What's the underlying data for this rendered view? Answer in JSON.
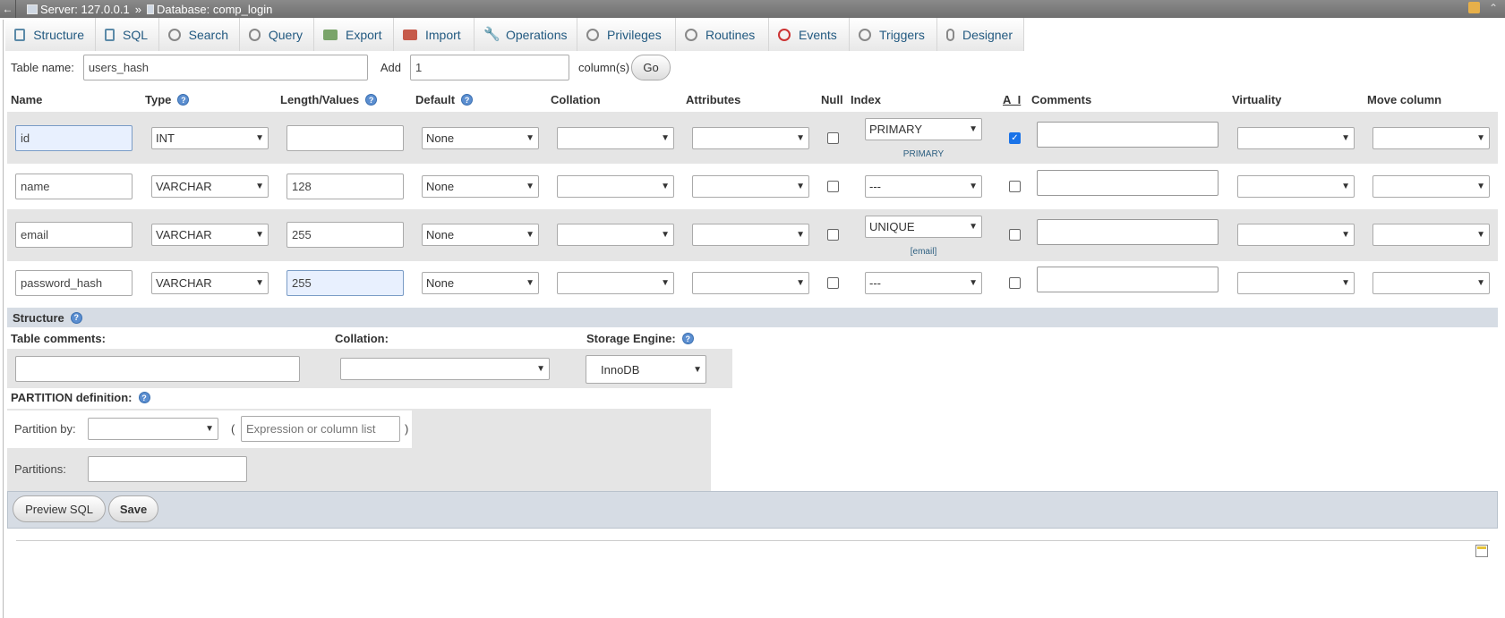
{
  "topbar": {
    "back": "←",
    "server": "Server: 127.0.0.1",
    "separator": "»",
    "database": "Database: comp_login",
    "up": "⌃"
  },
  "tabs": [
    {
      "label": "Structure",
      "icon": "structure-icon"
    },
    {
      "label": "SQL",
      "icon": "sql-icon"
    },
    {
      "label": "Search",
      "icon": "search-icon"
    },
    {
      "label": "Query",
      "icon": "query-icon"
    },
    {
      "label": "Export",
      "icon": "export-icon"
    },
    {
      "label": "Import",
      "icon": "import-icon"
    },
    {
      "label": "Operations",
      "icon": "wrench-icon"
    },
    {
      "label": "Privileges",
      "icon": "privileges-icon"
    },
    {
      "label": "Routines",
      "icon": "routines-icon"
    },
    {
      "label": "Events",
      "icon": "events-icon"
    },
    {
      "label": "Triggers",
      "icon": "triggers-icon"
    },
    {
      "label": "Designer",
      "icon": "designer-icon"
    }
  ],
  "form": {
    "table_name_label": "Table name:",
    "table_name": "users_hash",
    "add_label": "Add",
    "add_count": "1",
    "columns_label": "column(s)",
    "go": "Go"
  },
  "headers": {
    "name": "Name",
    "type": "Type",
    "length": "Length/Values",
    "default": "Default",
    "collation": "Collation",
    "attributes": "Attributes",
    "null": "Null",
    "index": "Index",
    "ai": "A_I",
    "comments": "Comments",
    "virtuality": "Virtuality",
    "move": "Move column"
  },
  "columns": [
    {
      "name": "id",
      "type": "INT",
      "length": "",
      "default": "None",
      "index": "PRIMARY",
      "index_sub": "PRIMARY",
      "ai": true
    },
    {
      "name": "name",
      "type": "VARCHAR",
      "length": "128",
      "default": "None",
      "index": "---",
      "index_sub": "",
      "ai": false
    },
    {
      "name": "email",
      "type": "VARCHAR",
      "length": "255",
      "default": "None",
      "index": "UNIQUE",
      "index_sub": "[email]",
      "ai": false
    },
    {
      "name": "password_hash",
      "type": "VARCHAR",
      "length": "255",
      "default": "None",
      "index": "---",
      "index_sub": "",
      "ai": false
    }
  ],
  "structure": {
    "title": "Structure",
    "table_comments_label": "Table comments:",
    "collation_label": "Collation:",
    "engine_label": "Storage Engine:",
    "engine": "InnoDB"
  },
  "partition": {
    "title": "PARTITION definition:",
    "by_label": "Partition by:",
    "open_paren": "(",
    "close_paren": ")",
    "expr_placeholder": "Expression or column list",
    "partitions_label": "Partitions:"
  },
  "buttons": {
    "preview_sql": "Preview SQL",
    "save": "Save"
  }
}
